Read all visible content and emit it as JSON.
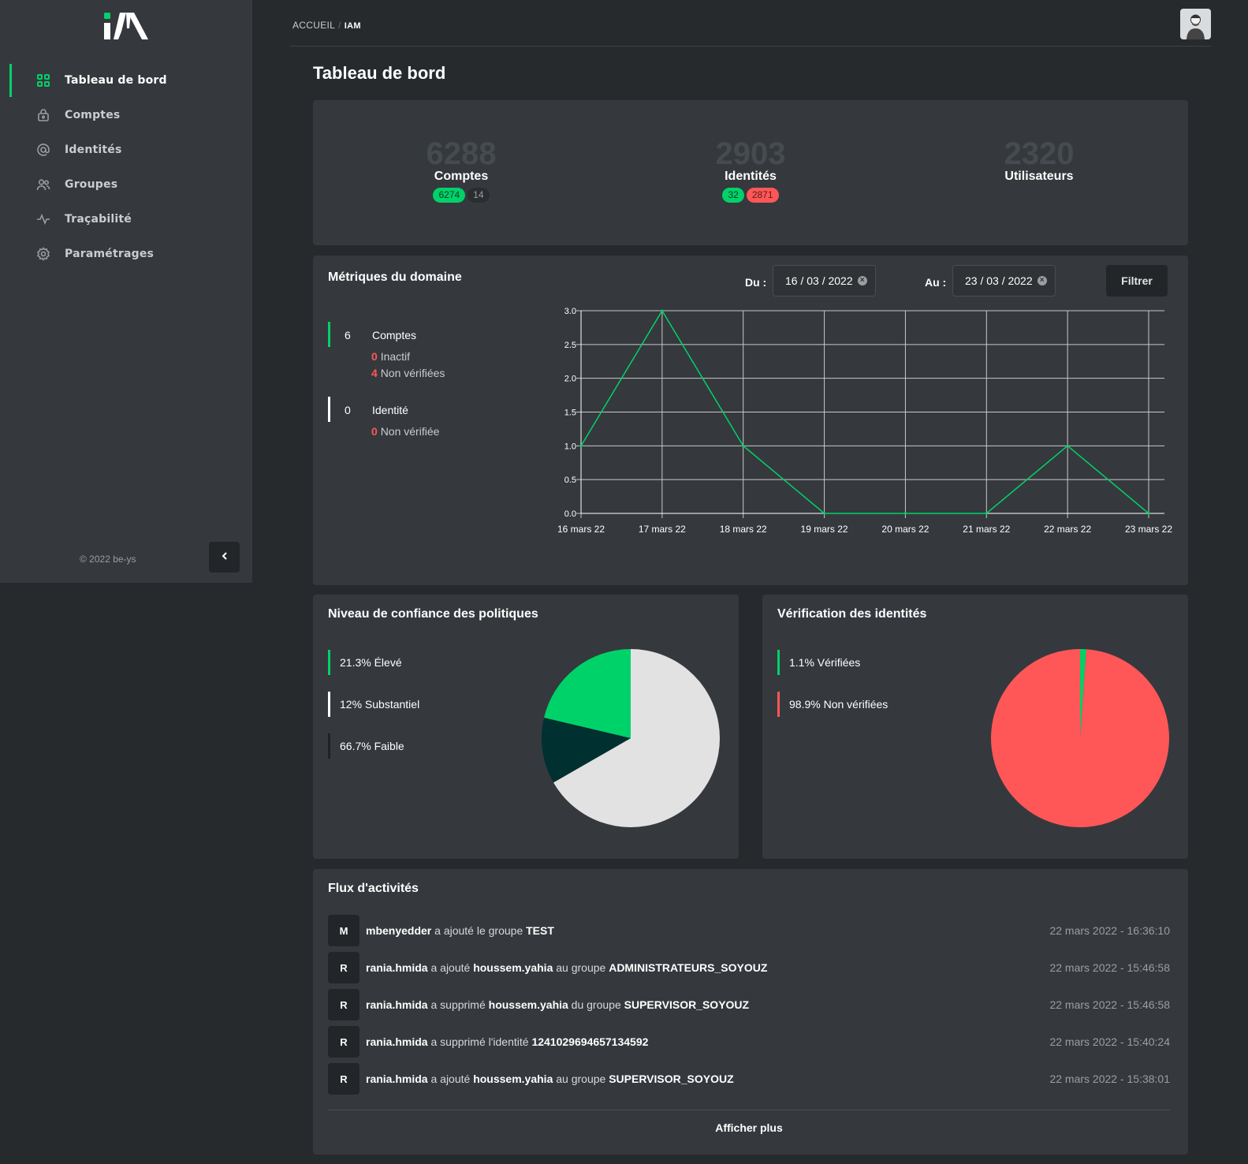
{
  "app": {
    "logo_text": "iAM",
    "copyright": "© 2022 be-ys"
  },
  "sidebar": {
    "items": [
      {
        "label": "Tableau de bord",
        "icon": "grid-icon",
        "active": true
      },
      {
        "label": "Comptes",
        "icon": "lock-icon",
        "active": false
      },
      {
        "label": "Identités",
        "icon": "at-icon",
        "active": false
      },
      {
        "label": "Groupes",
        "icon": "users-icon",
        "active": false
      },
      {
        "label": "Traçabilité",
        "icon": "activity-icon",
        "active": false
      },
      {
        "label": "Paramétrages",
        "icon": "gear-icon",
        "active": false
      }
    ]
  },
  "breadcrumb": {
    "home": "ACCUEIL",
    "sep": "/",
    "current": "IAM"
  },
  "page": {
    "title": "Tableau de bord"
  },
  "stats": [
    {
      "value": "6288",
      "label": "Comptes",
      "badges": [
        {
          "text": "6274",
          "style": "green"
        },
        {
          "text": "14",
          "style": "dark"
        }
      ]
    },
    {
      "value": "2903",
      "label": "Identités",
      "badges": [
        {
          "text": "32",
          "style": "green"
        },
        {
          "text": "2871",
          "style": "red"
        }
      ]
    },
    {
      "value": "2320",
      "label": "Utilisateurs",
      "badges": []
    }
  ],
  "metrics": {
    "title": "Métriques du domaine",
    "from_label": "Du :",
    "from_value": "16 / 03 / 2022",
    "to_label": "Au :",
    "to_value": "23 / 03 / 2022",
    "filter_label": "Filtrer",
    "clear_glyph": "×",
    "comptes": {
      "count": "6",
      "label": "Comptes",
      "inactive_count": "0",
      "inactive_label": "Inactif",
      "unverified_count": "4",
      "unverified_label": "Non vérifiées"
    },
    "identite": {
      "count": "0",
      "label": "Identité",
      "unverified_count": "0",
      "unverified_label": "Non vérifiée"
    }
  },
  "chart_data": [
    {
      "type": "line",
      "x": [
        "16 mars 22",
        "17 mars 22",
        "18 mars 22",
        "19 mars 22",
        "20 mars 22",
        "21 mars 22",
        "22 mars 22",
        "23 mars 22"
      ],
      "series": [
        {
          "values": [
            1,
            3,
            1,
            0,
            0,
            0,
            1,
            0
          ],
          "color": "#00d26a"
        }
      ],
      "ylim": [
        0,
        3
      ],
      "yticks": [
        "0.0",
        "0.5",
        "1.0",
        "1.5",
        "2.0",
        "2.5",
        "3.0"
      ],
      "grid": true
    },
    {
      "type": "pie",
      "title": "Niveau de confiance des politiques",
      "slices": [
        {
          "label": "Élevé",
          "percent": 21.3,
          "text": "21.3% Élevé",
          "color": "#00d26a"
        },
        {
          "label": "Substantiel",
          "percent": 12,
          "text": "12% Substantiel",
          "color": "#003030"
        },
        {
          "label": "Faible",
          "percent": 66.7,
          "text": "66.7% Faible",
          "color": "#e2e2e2"
        }
      ]
    },
    {
      "type": "pie",
      "title": "Vérification des identités",
      "slices": [
        {
          "label": "Vérifiées",
          "percent": 1.1,
          "text": "1.1% Vérifiées",
          "color": "#00d26a"
        },
        {
          "label": "Non vérifiées",
          "percent": 98.9,
          "text": "98.9% Non vérifiées",
          "color": "#ff5757"
        }
      ]
    }
  ],
  "legends": {
    "confiance": [
      {
        "text": "21.3% Élevé",
        "color": "#00d26a"
      },
      {
        "text": "12% Substantiel",
        "color": "#ffffff"
      },
      {
        "text": "66.7% Faible",
        "color": "#1f2326"
      }
    ],
    "verification": [
      {
        "text": "1.1% Vérifiées",
        "color": "#00d26a"
      },
      {
        "text": "98.9% Non vérifiées",
        "color": "#ff5757"
      }
    ]
  },
  "activity": {
    "title": "Flux d'activités",
    "more_label": "Afficher plus",
    "rows": [
      {
        "initial": "M",
        "parts": [
          [
            "b",
            "mbenyedder"
          ],
          [
            "t",
            " a ajouté le groupe "
          ],
          [
            "b",
            "TEST"
          ]
        ],
        "time": "22 mars 2022 - 16:36:10"
      },
      {
        "initial": "R",
        "parts": [
          [
            "b",
            "rania.hmida"
          ],
          [
            "t",
            " a ajouté "
          ],
          [
            "b",
            "houssem.yahia"
          ],
          [
            "t",
            " au groupe "
          ],
          [
            "b",
            "ADMINISTRATEURS_SOYOUZ"
          ]
        ],
        "time": "22 mars 2022 - 15:46:58"
      },
      {
        "initial": "R",
        "parts": [
          [
            "b",
            "rania.hmida"
          ],
          [
            "t",
            " a supprimé "
          ],
          [
            "b",
            "houssem.yahia"
          ],
          [
            "t",
            " du groupe "
          ],
          [
            "b",
            "SUPERVISOR_SOYOUZ"
          ]
        ],
        "time": "22 mars 2022 - 15:46:58"
      },
      {
        "initial": "R",
        "parts": [
          [
            "b",
            "rania.hmida"
          ],
          [
            "t",
            " a supprimé l'identité "
          ],
          [
            "b",
            "1241029694657134592"
          ]
        ],
        "time": "22 mars 2022 - 15:40:24"
      },
      {
        "initial": "R",
        "parts": [
          [
            "b",
            "rania.hmida"
          ],
          [
            "t",
            " a ajouté "
          ],
          [
            "b",
            "houssem.yahia"
          ],
          [
            "t",
            " au groupe "
          ],
          [
            "b",
            "SUPERVISOR_SOYOUZ"
          ]
        ],
        "time": "22 mars 2022 - 15:38:01"
      }
    ]
  },
  "colors": {
    "accent": "#00d26a",
    "danger": "#ff5757",
    "card": "#35393d",
    "background": "#262a2d"
  }
}
